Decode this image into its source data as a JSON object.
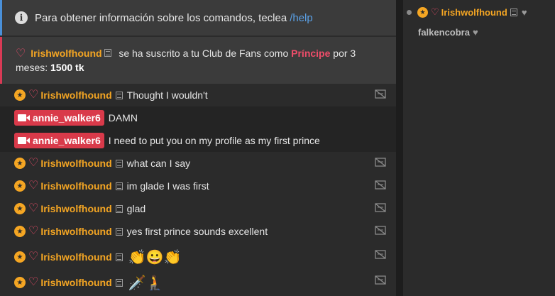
{
  "notice": {
    "text": "Para obtener información sobre los comandos, teclea",
    "link": "/help"
  },
  "subscription": {
    "user": "Irishwolfhound",
    "text1": "se ha suscrito a tu Club de Fans como",
    "tier": "Príncipe",
    "text2": "por 3 meses:",
    "amount": "1500 tk"
  },
  "messages": [
    {
      "user": "Irishwolfhound",
      "text": "Thought I wouldn't"
    },
    {
      "user": "annie_walker6",
      "text": "DAMN"
    },
    {
      "user": "annie_walker6",
      "text": "I need to put you on my profile as my first prince"
    },
    {
      "user": "Irishwolfhound",
      "text": "what can I say"
    },
    {
      "user": "Irishwolfhound",
      "text": "im glade I was first"
    },
    {
      "user": "Irishwolfhound",
      "text": "glad"
    },
    {
      "user": "Irishwolfhound",
      "text": "yes first prince sounds excellent"
    },
    {
      "user": "Irishwolfhound",
      "text": "👏😀👏"
    },
    {
      "user": "Irishwolfhound",
      "text": "🗡️🧎"
    }
  ],
  "side_users": [
    {
      "name": "Irishwolfhound"
    },
    {
      "name": "falkencobra"
    }
  ],
  "colors": {
    "accent_orange": "#f5a623",
    "accent_red": "#f04d6a",
    "info_blue": "#4a90d9"
  }
}
